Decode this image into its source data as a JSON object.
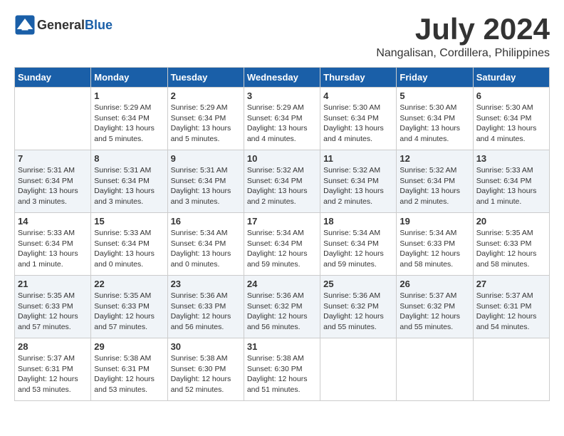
{
  "header": {
    "logo_general": "General",
    "logo_blue": "Blue",
    "month_year": "July 2024",
    "location": "Nangalisan, Cordillera, Philippines"
  },
  "weekdays": [
    "Sunday",
    "Monday",
    "Tuesday",
    "Wednesday",
    "Thursday",
    "Friday",
    "Saturday"
  ],
  "weeks": [
    [
      {
        "day": "",
        "sunrise": "",
        "sunset": "",
        "daylight": ""
      },
      {
        "day": "1",
        "sunrise": "Sunrise: 5:29 AM",
        "sunset": "Sunset: 6:34 PM",
        "daylight": "Daylight: 13 hours and 5 minutes."
      },
      {
        "day": "2",
        "sunrise": "Sunrise: 5:29 AM",
        "sunset": "Sunset: 6:34 PM",
        "daylight": "Daylight: 13 hours and 5 minutes."
      },
      {
        "day": "3",
        "sunrise": "Sunrise: 5:29 AM",
        "sunset": "Sunset: 6:34 PM",
        "daylight": "Daylight: 13 hours and 4 minutes."
      },
      {
        "day": "4",
        "sunrise": "Sunrise: 5:30 AM",
        "sunset": "Sunset: 6:34 PM",
        "daylight": "Daylight: 13 hours and 4 minutes."
      },
      {
        "day": "5",
        "sunrise": "Sunrise: 5:30 AM",
        "sunset": "Sunset: 6:34 PM",
        "daylight": "Daylight: 13 hours and 4 minutes."
      },
      {
        "day": "6",
        "sunrise": "Sunrise: 5:30 AM",
        "sunset": "Sunset: 6:34 PM",
        "daylight": "Daylight: 13 hours and 4 minutes."
      }
    ],
    [
      {
        "day": "7",
        "sunrise": "Sunrise: 5:31 AM",
        "sunset": "Sunset: 6:34 PM",
        "daylight": "Daylight: 13 hours and 3 minutes."
      },
      {
        "day": "8",
        "sunrise": "Sunrise: 5:31 AM",
        "sunset": "Sunset: 6:34 PM",
        "daylight": "Daylight: 13 hours and 3 minutes."
      },
      {
        "day": "9",
        "sunrise": "Sunrise: 5:31 AM",
        "sunset": "Sunset: 6:34 PM",
        "daylight": "Daylight: 13 hours and 3 minutes."
      },
      {
        "day": "10",
        "sunrise": "Sunrise: 5:32 AM",
        "sunset": "Sunset: 6:34 PM",
        "daylight": "Daylight: 13 hours and 2 minutes."
      },
      {
        "day": "11",
        "sunrise": "Sunrise: 5:32 AM",
        "sunset": "Sunset: 6:34 PM",
        "daylight": "Daylight: 13 hours and 2 minutes."
      },
      {
        "day": "12",
        "sunrise": "Sunrise: 5:32 AM",
        "sunset": "Sunset: 6:34 PM",
        "daylight": "Daylight: 13 hours and 2 minutes."
      },
      {
        "day": "13",
        "sunrise": "Sunrise: 5:33 AM",
        "sunset": "Sunset: 6:34 PM",
        "daylight": "Daylight: 13 hours and 1 minute."
      }
    ],
    [
      {
        "day": "14",
        "sunrise": "Sunrise: 5:33 AM",
        "sunset": "Sunset: 6:34 PM",
        "daylight": "Daylight: 13 hours and 1 minute."
      },
      {
        "day": "15",
        "sunrise": "Sunrise: 5:33 AM",
        "sunset": "Sunset: 6:34 PM",
        "daylight": "Daylight: 13 hours and 0 minutes."
      },
      {
        "day": "16",
        "sunrise": "Sunrise: 5:34 AM",
        "sunset": "Sunset: 6:34 PM",
        "daylight": "Daylight: 13 hours and 0 minutes."
      },
      {
        "day": "17",
        "sunrise": "Sunrise: 5:34 AM",
        "sunset": "Sunset: 6:34 PM",
        "daylight": "Daylight: 12 hours and 59 minutes."
      },
      {
        "day": "18",
        "sunrise": "Sunrise: 5:34 AM",
        "sunset": "Sunset: 6:34 PM",
        "daylight": "Daylight: 12 hours and 59 minutes."
      },
      {
        "day": "19",
        "sunrise": "Sunrise: 5:34 AM",
        "sunset": "Sunset: 6:33 PM",
        "daylight": "Daylight: 12 hours and 58 minutes."
      },
      {
        "day": "20",
        "sunrise": "Sunrise: 5:35 AM",
        "sunset": "Sunset: 6:33 PM",
        "daylight": "Daylight: 12 hours and 58 minutes."
      }
    ],
    [
      {
        "day": "21",
        "sunrise": "Sunrise: 5:35 AM",
        "sunset": "Sunset: 6:33 PM",
        "daylight": "Daylight: 12 hours and 57 minutes."
      },
      {
        "day": "22",
        "sunrise": "Sunrise: 5:35 AM",
        "sunset": "Sunset: 6:33 PM",
        "daylight": "Daylight: 12 hours and 57 minutes."
      },
      {
        "day": "23",
        "sunrise": "Sunrise: 5:36 AM",
        "sunset": "Sunset: 6:33 PM",
        "daylight": "Daylight: 12 hours and 56 minutes."
      },
      {
        "day": "24",
        "sunrise": "Sunrise: 5:36 AM",
        "sunset": "Sunset: 6:32 PM",
        "daylight": "Daylight: 12 hours and 56 minutes."
      },
      {
        "day": "25",
        "sunrise": "Sunrise: 5:36 AM",
        "sunset": "Sunset: 6:32 PM",
        "daylight": "Daylight: 12 hours and 55 minutes."
      },
      {
        "day": "26",
        "sunrise": "Sunrise: 5:37 AM",
        "sunset": "Sunset: 6:32 PM",
        "daylight": "Daylight: 12 hours and 55 minutes."
      },
      {
        "day": "27",
        "sunrise": "Sunrise: 5:37 AM",
        "sunset": "Sunset: 6:31 PM",
        "daylight": "Daylight: 12 hours and 54 minutes."
      }
    ],
    [
      {
        "day": "28",
        "sunrise": "Sunrise: 5:37 AM",
        "sunset": "Sunset: 6:31 PM",
        "daylight": "Daylight: 12 hours and 53 minutes."
      },
      {
        "day": "29",
        "sunrise": "Sunrise: 5:38 AM",
        "sunset": "Sunset: 6:31 PM",
        "daylight": "Daylight: 12 hours and 53 minutes."
      },
      {
        "day": "30",
        "sunrise": "Sunrise: 5:38 AM",
        "sunset": "Sunset: 6:30 PM",
        "daylight": "Daylight: 12 hours and 52 minutes."
      },
      {
        "day": "31",
        "sunrise": "Sunrise: 5:38 AM",
        "sunset": "Sunset: 6:30 PM",
        "daylight": "Daylight: 12 hours and 51 minutes."
      },
      {
        "day": "",
        "sunrise": "",
        "sunset": "",
        "daylight": ""
      },
      {
        "day": "",
        "sunrise": "",
        "sunset": "",
        "daylight": ""
      },
      {
        "day": "",
        "sunrise": "",
        "sunset": "",
        "daylight": ""
      }
    ]
  ]
}
